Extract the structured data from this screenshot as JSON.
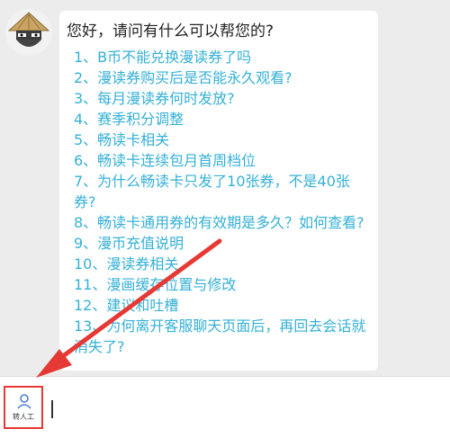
{
  "chat": {
    "greeting": "您好，请问有什么可以帮您的?",
    "faq_items": [
      "1、B币不能兑换漫读券了吗",
      "2、漫读券购买后是否能永久观看?",
      "3、每月漫读券何时发放?",
      "4、赛季积分调整",
      "5、畅读卡相关",
      "6、畅读卡连续包月首周档位",
      "7、为什么畅读卡只发了10张券，不是40张券?",
      "8、畅读卡通用券的有效期是多久？如何查看?",
      "9、漫币充值说明",
      "10、漫读券相关",
      "11、漫画缓存位置与修改",
      "12、建议和吐槽",
      "13、为何离开客服聊天页面后，再回去会话就消失了?"
    ]
  },
  "icons": {
    "avatar": "straw-hat-avatar-icon",
    "agent": "person-icon",
    "annotation": "red-arrow-annotation"
  },
  "bottom_bar": {
    "agent_button_label": "转人工"
  },
  "colors": {
    "faq_link": "#35b0d6",
    "highlight": "#e53935",
    "background": "#ececec"
  }
}
